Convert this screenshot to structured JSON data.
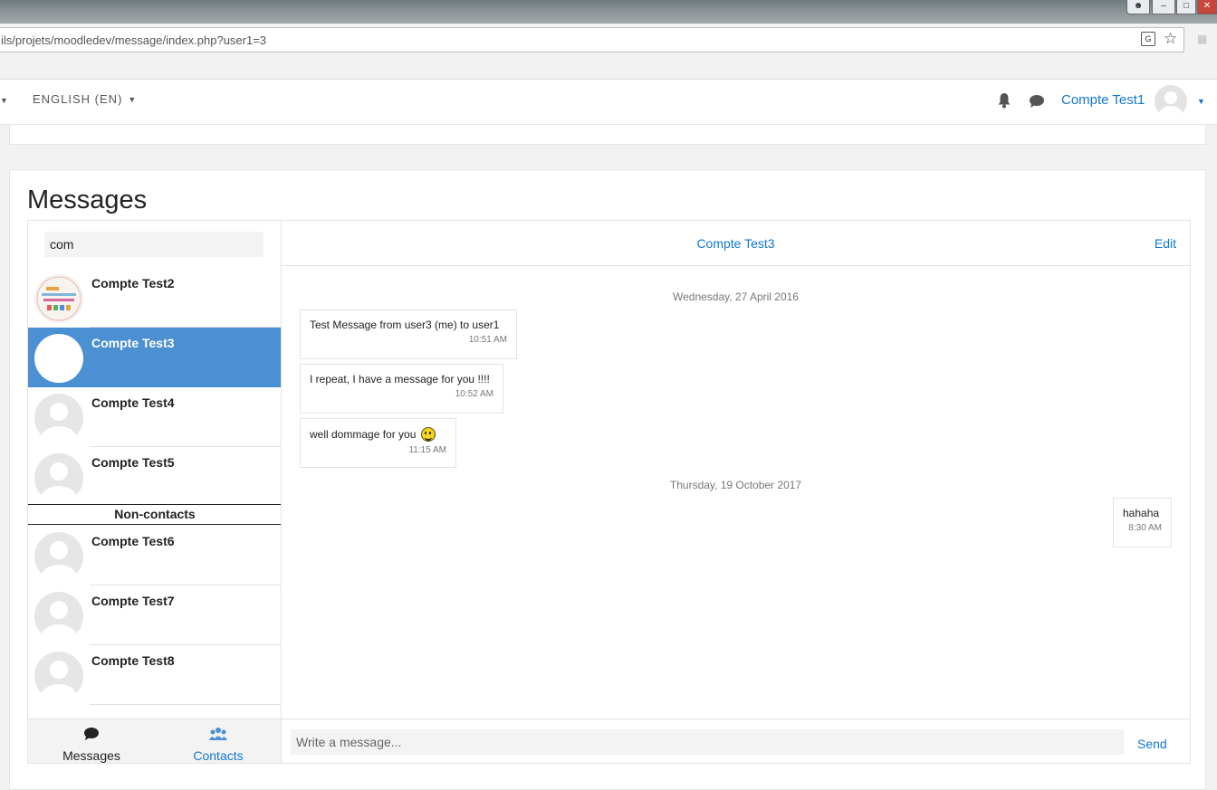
{
  "browser": {
    "url": "ils/projets/moodledev/message/index.php?user1=3"
  },
  "navbar": {
    "language": "ENGLISH (EN)",
    "user_name": "Compte Test1"
  },
  "page": {
    "title": "Messages"
  },
  "search": {
    "value": "com"
  },
  "contacts": [
    {
      "name": "Compte Test2",
      "selected": false,
      "has_picture": true
    },
    {
      "name": "Compte Test3",
      "selected": true,
      "has_picture": false
    },
    {
      "name": "Compte Test4",
      "selected": false,
      "has_picture": false
    },
    {
      "name": "Compte Test5",
      "selected": false,
      "has_picture": false
    }
  ],
  "noncontacts_label": "Non-contacts",
  "noncontacts": [
    {
      "name": "Compte Test6"
    },
    {
      "name": "Compte Test7"
    },
    {
      "name": "Compte Test8"
    }
  ],
  "tabs": {
    "messages": "Messages",
    "contacts": "Contacts"
  },
  "conversation": {
    "name": "Compte Test3",
    "edit_label": "Edit",
    "days": [
      {
        "date": "Wednesday, 27 April 2016",
        "messages": [
          {
            "text": "Test Message from user3 (me) to user1",
            "time": "10:51 AM",
            "side": "left"
          },
          {
            "text": "I repeat, I have a message for you !!!!",
            "time": "10:52 AM",
            "side": "left"
          },
          {
            "text": "well dommage for you",
            "time": "11:15 AM",
            "side": "left",
            "emoji": "smiley"
          }
        ]
      },
      {
        "date": "Thursday, 19 October 2017",
        "messages": [
          {
            "text": "hahaha",
            "time": "8:30 AM",
            "side": "right"
          }
        ]
      }
    ]
  },
  "compose": {
    "placeholder": "Write a message...",
    "send_label": "Send"
  },
  "colors": {
    "accent": "#1177d1",
    "selected_row": "#4a90d2"
  }
}
